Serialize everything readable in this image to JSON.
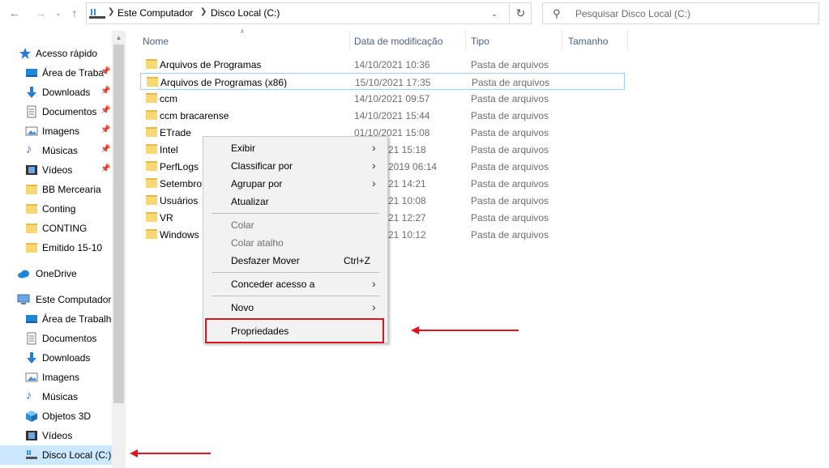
{
  "address_bar": {
    "crumbs": [
      "Este Computador",
      "Disco Local (C:)"
    ]
  },
  "search": {
    "placeholder": "Pesquisar Disco Local (C:)"
  },
  "sidebar": {
    "quick_access": "Acesso rápido",
    "quick_items": [
      {
        "label": "Área de Traba",
        "icon": "desktop-icon",
        "pinned": true
      },
      {
        "label": "Downloads",
        "icon": "download-icon",
        "pinned": true
      },
      {
        "label": "Documentos",
        "icon": "document-icon",
        "pinned": true
      },
      {
        "label": "Imagens",
        "icon": "pictures-icon",
        "pinned": true
      },
      {
        "label": "Músicas",
        "icon": "music-icon",
        "pinned": true
      },
      {
        "label": "Vídeos",
        "icon": "video-icon",
        "pinned": true
      },
      {
        "label": "BB Mercearia",
        "icon": "folder-icon",
        "pinned": false
      },
      {
        "label": "Conting",
        "icon": "folder-icon",
        "pinned": false
      },
      {
        "label": "CONTING",
        "icon": "folder-icon",
        "pinned": false
      },
      {
        "label": "Emitido 15-10",
        "icon": "folder-icon",
        "pinned": false
      }
    ],
    "onedrive": "OneDrive",
    "this_pc": "Este Computador",
    "pc_items": [
      {
        "label": "Área de Trabalho",
        "icon": "desktop-icon"
      },
      {
        "label": "Documentos",
        "icon": "document-icon"
      },
      {
        "label": "Downloads",
        "icon": "download-icon"
      },
      {
        "label": "Imagens",
        "icon": "pictures-icon"
      },
      {
        "label": "Músicas",
        "icon": "music-icon"
      },
      {
        "label": "Objetos 3D",
        "icon": "cube-icon"
      },
      {
        "label": "Vídeos",
        "icon": "video-icon"
      },
      {
        "label": "Disco Local (C:)",
        "icon": "drive-icon"
      }
    ]
  },
  "columns": {
    "name": "Nome",
    "date": "Data de modificação",
    "type": "Tipo",
    "size": "Tamanho"
  },
  "files": [
    {
      "name": "Arquivos de Programas",
      "date": "14/10/2021 10:36",
      "type": "Pasta de arquivos"
    },
    {
      "name": "Arquivos de Programas (x86)",
      "date": "15/10/2021 17:35",
      "type": "Pasta de arquivos"
    },
    {
      "name": "ccm",
      "date": "14/10/2021 09:57",
      "type": "Pasta de arquivos"
    },
    {
      "name": "ccm bracarense",
      "date": "14/10/2021 15:44",
      "type": "Pasta de arquivos"
    },
    {
      "name": "ETrade",
      "date": "01/10/2021 15:08",
      "type": "Pasta de arquivos"
    },
    {
      "name": "Intel",
      "date": "21 15:18",
      "type": "Pasta de arquivos"
    },
    {
      "name": "PerfLogs",
      "date": "2019 06:14",
      "type": "Pasta de arquivos"
    },
    {
      "name": "Setembro",
      "date": "21 14:21",
      "type": "Pasta de arquivos"
    },
    {
      "name": "Usuários",
      "date": "21 10:08",
      "type": "Pasta de arquivos"
    },
    {
      "name": "VR",
      "date": "21 12:27",
      "type": "Pasta de arquivos"
    },
    {
      "name": "Windows",
      "date": "21 10:12",
      "type": "Pasta de arquivos"
    }
  ],
  "context_menu": {
    "exibir": "Exibir",
    "classificar": "Classificar por",
    "agrupar": "Agrupar por",
    "atualizar": "Atualizar",
    "colar": "Colar",
    "colar_atalho": "Colar atalho",
    "desfazer": "Desfazer Mover",
    "desfazer_shortcut": "Ctrl+Z",
    "conceder": "Conceder acesso a",
    "novo": "Novo",
    "propriedades": "Propriedades"
  },
  "colors": {
    "annotation": "#e0141e",
    "selection": "#cce8ff",
    "folder": "#f8d775"
  }
}
